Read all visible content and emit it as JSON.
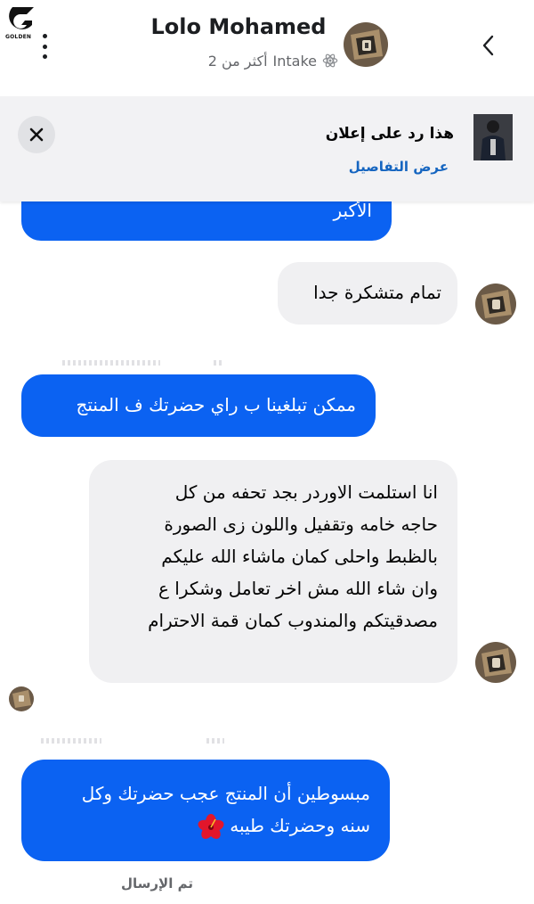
{
  "header": {
    "logo_text": "GOLDEN",
    "contact_name": "Lolo Mohamed",
    "subtitle_label": "Intake",
    "subtitle_count": "أكثر من 2",
    "icons": {
      "back": "chevron-left-icon",
      "menu": "more-vertical-icon",
      "subtitle": "atom-icon"
    }
  },
  "ad_banner": {
    "title": "هذا رد على إعلان",
    "link": "عرض التفاصيل",
    "close_icon": "close-icon"
  },
  "messages": [
    {
      "direction": "outgoing",
      "text": "الأكبر"
    },
    {
      "direction": "incoming",
      "text": "تمام متشكرة جدا"
    },
    {
      "direction": "outgoing",
      "text": "ممكن تبلغينا ب راي حضرتك ف المنتج"
    },
    {
      "direction": "incoming",
      "lines": [
        "انا استلمت الاوردر بجد تحفه من كل",
        "حاجه خامه وتقفيل واللون زى الصورة",
        "بالظبط واحلى كمان ماشاء الله عليكم",
        "وان شاء الله مش اخر تعامل وشكرا ع",
        "مصدقيتكم والمندوب كمان قمة الاحترام"
      ]
    },
    {
      "direction": "outgoing",
      "lines": [
        "مبسوطين أن المنتج عجب حضرتك وكل",
        "سنه وحضرتك طيبه"
      ],
      "emoji": "hibiscus"
    }
  ],
  "status": {
    "sent": "تم الإرسال"
  },
  "colors": {
    "outgoing_bubble": "#0b62f2",
    "incoming_bubble": "#f0f0f2",
    "link": "#1565c0",
    "secondary_text": "#65676b"
  }
}
